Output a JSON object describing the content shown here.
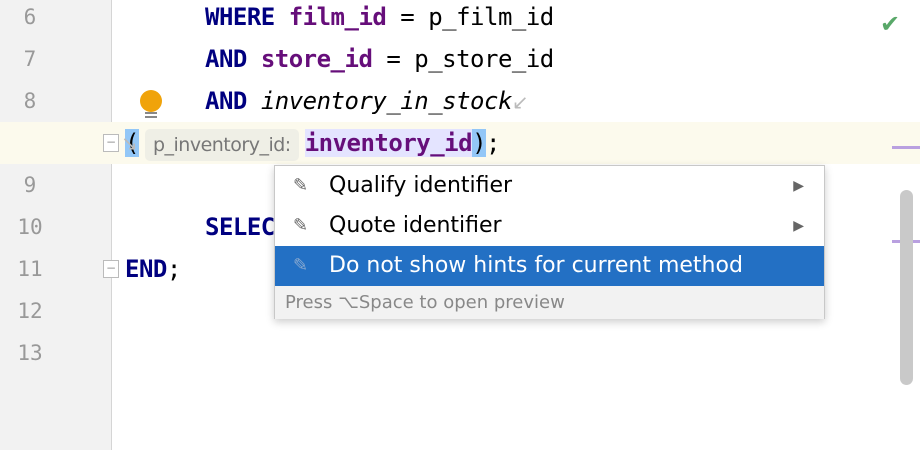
{
  "gutter": {
    "line_numbers": [
      "6",
      "7",
      "8",
      "9",
      "10",
      "11",
      "12",
      "13"
    ]
  },
  "code": {
    "line6": {
      "kw": "WHERE",
      "col": "film_id",
      "rest": " = p_film_id"
    },
    "line7": {
      "kw": "AND",
      "col": "store_id",
      "rest": " = p_store_id"
    },
    "line8": {
      "kw": "AND",
      "fn": "inventory_in_stock"
    },
    "line8b": {
      "open": "(",
      "hint": "p_inventory_id:",
      "arg": "inventory_id",
      "close": ")",
      "end": ";"
    },
    "line10": {
      "kw": "SELEC"
    },
    "line11": {
      "kw": "END",
      "end": ";"
    }
  },
  "popup": {
    "items": [
      {
        "label": "Qualify identifier",
        "icon": "edit-icon",
        "submenu": true
      },
      {
        "label": "Quote identifier",
        "icon": "edit-icon",
        "submenu": true
      },
      {
        "label": "Do not show hints for current method",
        "icon": "edit-icon",
        "submenu": false
      }
    ],
    "footer": "Press ⌥Space to open preview"
  },
  "status": {
    "check": "✔"
  },
  "colors": {
    "keyword": "#000080",
    "column": "#660e7a",
    "selection": "#2370c4",
    "bulb": "#f0a30a"
  }
}
